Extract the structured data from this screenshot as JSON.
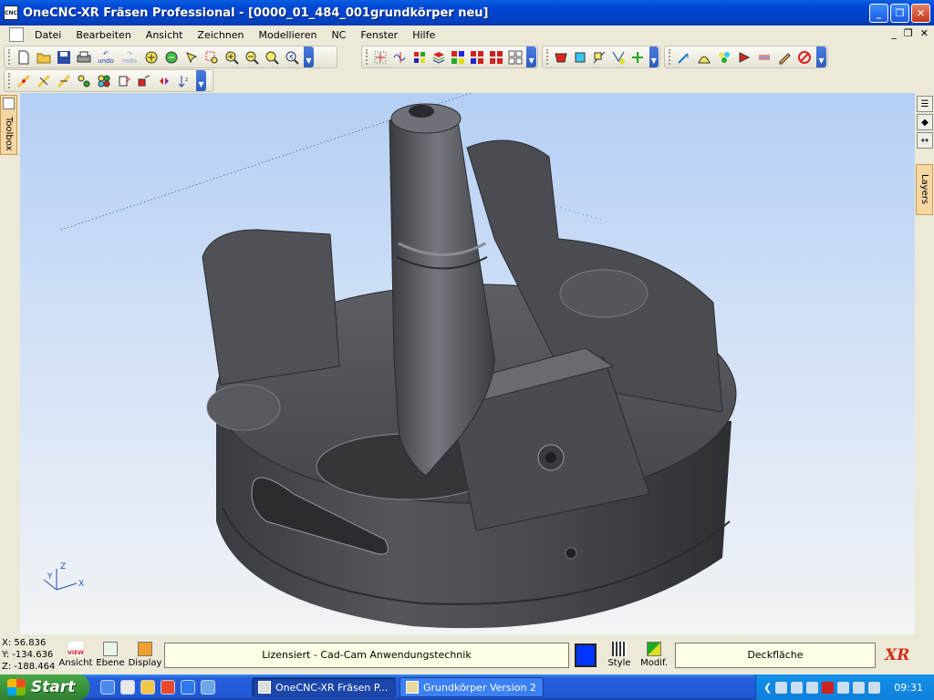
{
  "window": {
    "title": "OneCNC-XR Fräsen Professional - [0000_01_484_001grundkörper neu]",
    "app_icon": "onecnc-app-icon"
  },
  "menu": {
    "items": [
      "Datei",
      "Bearbeiten",
      "Ansicht",
      "Zeichnen",
      "Modellieren",
      "NC",
      "Fenster",
      "Hilfe"
    ]
  },
  "toolbars": {
    "row1_group1": [
      "new-file-icon",
      "open-folder-icon",
      "save-icon",
      "print-icon",
      "undo-icon",
      "redo-icon",
      "zoom-cursor-icon",
      "zoom-all-icon",
      "pan-icon",
      "zoom-window-icon",
      "zoom-in-icon",
      "zoom-out-icon",
      "zoom-fit-icon",
      "zoom-previous-icon"
    ],
    "undo_label": "undo",
    "redo_label": "redo"
  },
  "side": {
    "toolbox_label": "Toolbox",
    "layers_label": "Layers"
  },
  "status": {
    "x": "X: 56.836",
    "y": "Y: -134.636",
    "z": "Z: -188.464",
    "view_label": "Ansicht",
    "view_icon_text": "VIEW",
    "plane_label": "Ebene",
    "display_label": "Display",
    "license": "Lizensiert - Cad-Cam Anwendungstechnik",
    "style_label": "Style",
    "modif_label": "Modif.",
    "surface": "Deckfläche",
    "logo": "XR",
    "current_color": "#0033ff"
  },
  "taskbar": {
    "start": "Start",
    "tasks": [
      "OneCNC-XR Fräsen P...",
      "Grundkörper Version 2"
    ],
    "clock": "09:31"
  },
  "viewport": {
    "axis_labels": [
      "Z",
      "Y",
      "X"
    ]
  }
}
